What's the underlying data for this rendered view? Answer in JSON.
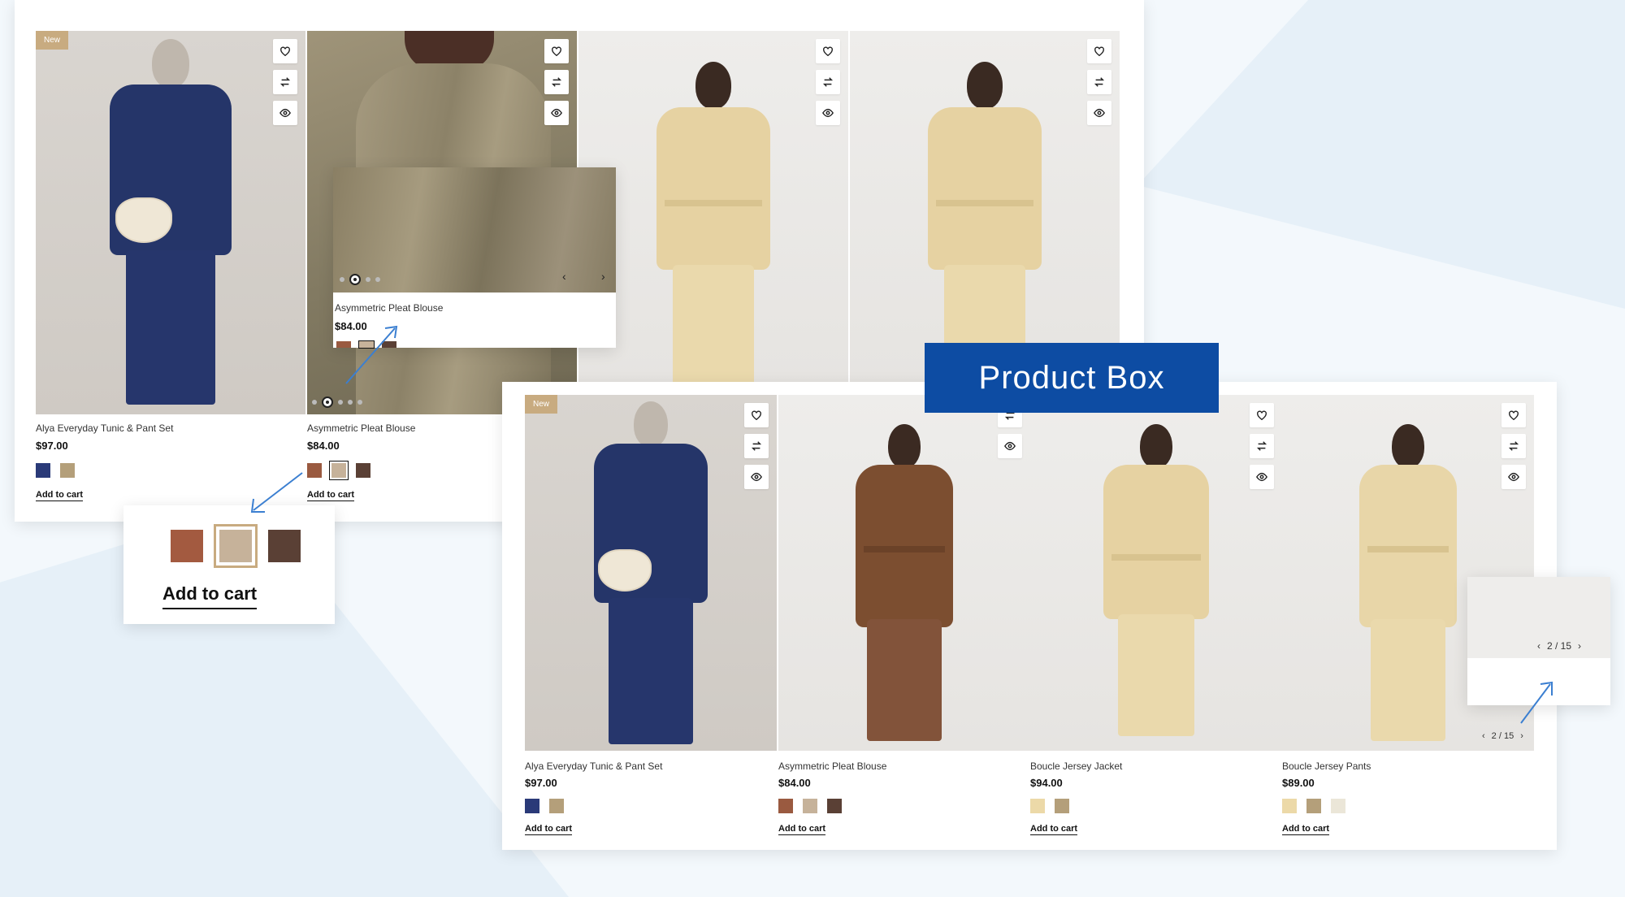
{
  "top_grid": {
    "products": [
      {
        "badge": "New",
        "name": "Alya Everyday Tunic & Pant Set",
        "price": "$97.00",
        "swatches": [
          "#2a3a78",
          "#b49f7a"
        ],
        "selected": -1,
        "add_to_cart": "Add to cart"
      },
      {
        "badge": "",
        "name": "Asymmetric Pleat Blouse",
        "price": "$84.00",
        "swatches": [
          "#9a5a40",
          "#c6b29a",
          "#5a4035"
        ],
        "selected": 1,
        "add_to_cart": "Add to cart"
      },
      {
        "badge": "",
        "name": "",
        "price": "",
        "swatches": [],
        "selected": -1,
        "add_to_cart": ""
      },
      {
        "badge": "",
        "name": "",
        "price": "",
        "swatches": [],
        "selected": -1,
        "add_to_cart": ""
      }
    ]
  },
  "zoom_hover": {
    "name": "Asymmetric Pleat Blouse",
    "price": "$84.00"
  },
  "zoom_swatches": {
    "swatches": [
      "#a35a40",
      "#c6b29a",
      "#5a4035"
    ],
    "selected": 1,
    "add_to_cart": "Add to cart"
  },
  "label": {
    "text": "Product Box"
  },
  "bottom_grid": {
    "products": [
      {
        "badge": "New",
        "name": "Alya Everyday Tunic & Pant Set",
        "price": "$97.00",
        "swatches": [
          "#2a3a78",
          "#b49f7a"
        ],
        "add_to_cart": "Add to cart"
      },
      {
        "badge": "",
        "name": "Asymmetric Pleat Blouse",
        "price": "$84.00",
        "swatches": [
          "#9a5a40",
          "#c6b29a",
          "#5a4035"
        ],
        "add_to_cart": "Add to cart"
      },
      {
        "badge": "",
        "name": "Boucle Jersey Jacket",
        "price": "$94.00",
        "swatches": [
          "#ecd9a8",
          "#b49f7a"
        ],
        "add_to_cart": "Add to cart"
      },
      {
        "badge": "",
        "name": "Boucle Jersey Pants",
        "price": "$89.00",
        "swatches": [
          "#ecd9a8",
          "#b49f7a",
          "#ebe6d8"
        ],
        "add_to_cart": "Add to cart",
        "pager": "2 / 15"
      }
    ]
  },
  "zoom_pager": {
    "text": "2 / 15"
  },
  "colors": {
    "accent_blue": "#0d4ca3",
    "badge": "#c8ab80",
    "arrow": "#3b7fd1"
  },
  "icons": [
    "heart-icon",
    "compare-icon",
    "eye-icon",
    "chevron-left-icon",
    "chevron-right-icon"
  ]
}
